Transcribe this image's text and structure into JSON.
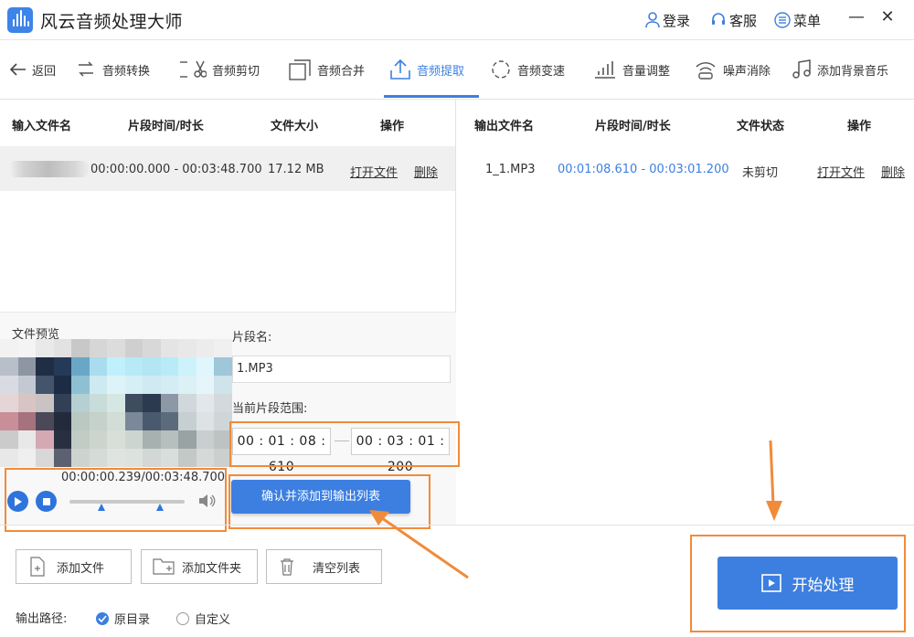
{
  "app": {
    "title": "风云音频处理大师",
    "login": "登录",
    "service": "客服",
    "menu": "菜单"
  },
  "toolbar": {
    "back": "返回",
    "items": [
      "音频转换",
      "音频剪切",
      "音频合并",
      "音频提取",
      "音频变速",
      "音量调整",
      "噪声消除",
      "添加背景音乐"
    ],
    "active_index": 3
  },
  "input_table": {
    "headers": [
      "输入文件名",
      "片段时间/时长",
      "文件大小",
      "操作"
    ],
    "row": {
      "range": "00:00:00.000 - 00:03:48.700",
      "size": "17.12 MB",
      "open": "打开文件",
      "delete": "删除"
    }
  },
  "output_table": {
    "headers": [
      "输出文件名",
      "片段时间/时长",
      "文件状态",
      "操作"
    ],
    "row": {
      "name": "1_1.MP3",
      "range": "00:01:08.610 - 00:03:01.200",
      "status": "未剪切",
      "open": "打开文件",
      "delete": "删除"
    }
  },
  "preview": {
    "label": "文件预览",
    "time": "00:00:00.239/00:03:48.700"
  },
  "segment": {
    "name_label": "片段名:",
    "name_value": "1.MP3",
    "range_label": "当前片段范围:",
    "start": "00 : 01 : 08 : 610",
    "end": "00 : 03 : 01 : 200",
    "confirm": "确认并添加到输出列表"
  },
  "footer": {
    "add_file": "添加文件",
    "add_folder": "添加文件夹",
    "clear_list": "清空列表",
    "output_path_label": "输出路径:",
    "option_original": "原目录",
    "option_custom": "自定义",
    "start": "开始处理"
  },
  "colors": {
    "accent": "#3d7fe0",
    "highlight": "#f08b3a"
  }
}
